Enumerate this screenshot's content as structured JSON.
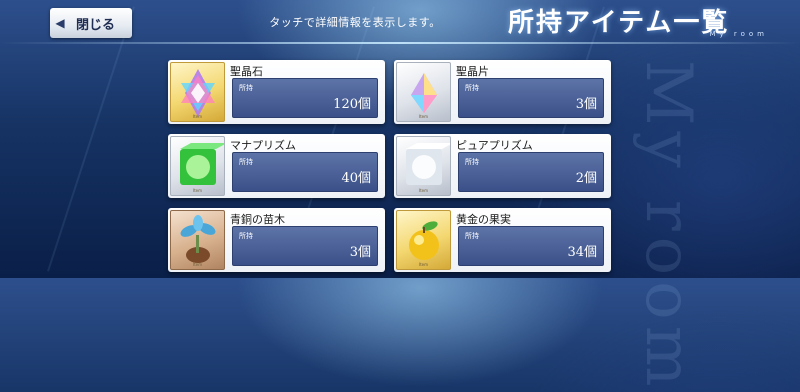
{
  "header": {
    "back_label": "閉じる",
    "hint": "タッチで詳細情報を表示します。",
    "title": "所持アイテム一覧",
    "subtitle": "My room",
    "deco": "My room"
  },
  "items": [
    {
      "name": "聖晶石",
      "owned_label": "所持",
      "count": "120個",
      "frame": "gold",
      "icon": "saint-quartz-icon",
      "tag": "Item"
    },
    {
      "name": "聖晶片",
      "owned_label": "所持",
      "count": "3個",
      "frame": "silver",
      "icon": "saint-quartz-fragment-icon",
      "tag": "Item"
    },
    {
      "name": "マナプリズム",
      "owned_label": "所持",
      "count": "40個",
      "frame": "silver",
      "icon": "mana-prism-icon",
      "tag": "Item"
    },
    {
      "name": "ピュアプリズム",
      "owned_label": "所持",
      "count": "2個",
      "frame": "silver",
      "icon": "pure-prism-icon",
      "tag": "Item"
    },
    {
      "name": "青銅の苗木",
      "owned_label": "所持",
      "count": "3個",
      "frame": "bronze",
      "icon": "bronze-sapling-icon",
      "tag": "Item"
    },
    {
      "name": "黄金の果実",
      "owned_label": "所持",
      "count": "34個",
      "frame": "gold",
      "icon": "golden-fruit-icon",
      "tag": "Item"
    }
  ]
}
